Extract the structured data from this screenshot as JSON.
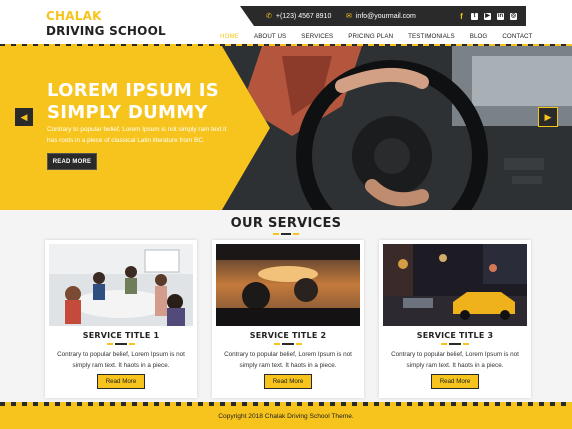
{
  "brand": {
    "line1": "CHALAK",
    "line2": "DRIVING SCHOOL"
  },
  "topbar": {
    "phone": "+(123) 4567 8910",
    "email": "info@yourmail.com",
    "socials": [
      {
        "name": "facebook-icon",
        "glyph": "f"
      },
      {
        "name": "twitter-icon",
        "glyph": "t"
      },
      {
        "name": "youtube-icon",
        "glyph": "▶"
      },
      {
        "name": "linkedin-icon",
        "glyph": "in"
      },
      {
        "name": "instagram-icon",
        "glyph": "◎"
      }
    ]
  },
  "nav": {
    "items": [
      "HOME",
      "ABOUT US",
      "SERVICES",
      "PRICING PLAN",
      "TESTIMONIALS",
      "BLOG",
      "CONTACT"
    ],
    "active": "HOME"
  },
  "hero": {
    "title_line1": "LOREM IPSUM IS",
    "title_line2": "SIMPLY DUMMY",
    "text": "Contrary to popular belief, Lorem Ipsum is not simply ram text it has roots in a piece of classical Latin literature from BC.",
    "button": "READ MORE",
    "prev_glyph": "◀",
    "next_glyph": "▶"
  },
  "services": {
    "heading": "OUR SERVICES",
    "cards": [
      {
        "title": "SERVICE TITLE 1",
        "text": "Contrary to popular belief, Lorem Ipsum is not simply ram text. It haots in a piece.",
        "button": "Read More"
      },
      {
        "title": "SERVICE TITLE 2",
        "text": "Contrary to popular belief, Lorem Ipsum is not simply ram text. It haots in a piece.",
        "button": "Read More"
      },
      {
        "title": "SERVICE TITLE 3",
        "text": "Contrary to popular belief, Lorem Ipsum is not simply ram text. It haots in a piece.",
        "button": "Read More"
      }
    ]
  },
  "footer": {
    "copyright": "Copyright 2018 Chalak Driving School Theme."
  },
  "colors": {
    "accent": "#f6c41c",
    "dark": "#2a2a2a",
    "background": "#f4f4f4"
  }
}
